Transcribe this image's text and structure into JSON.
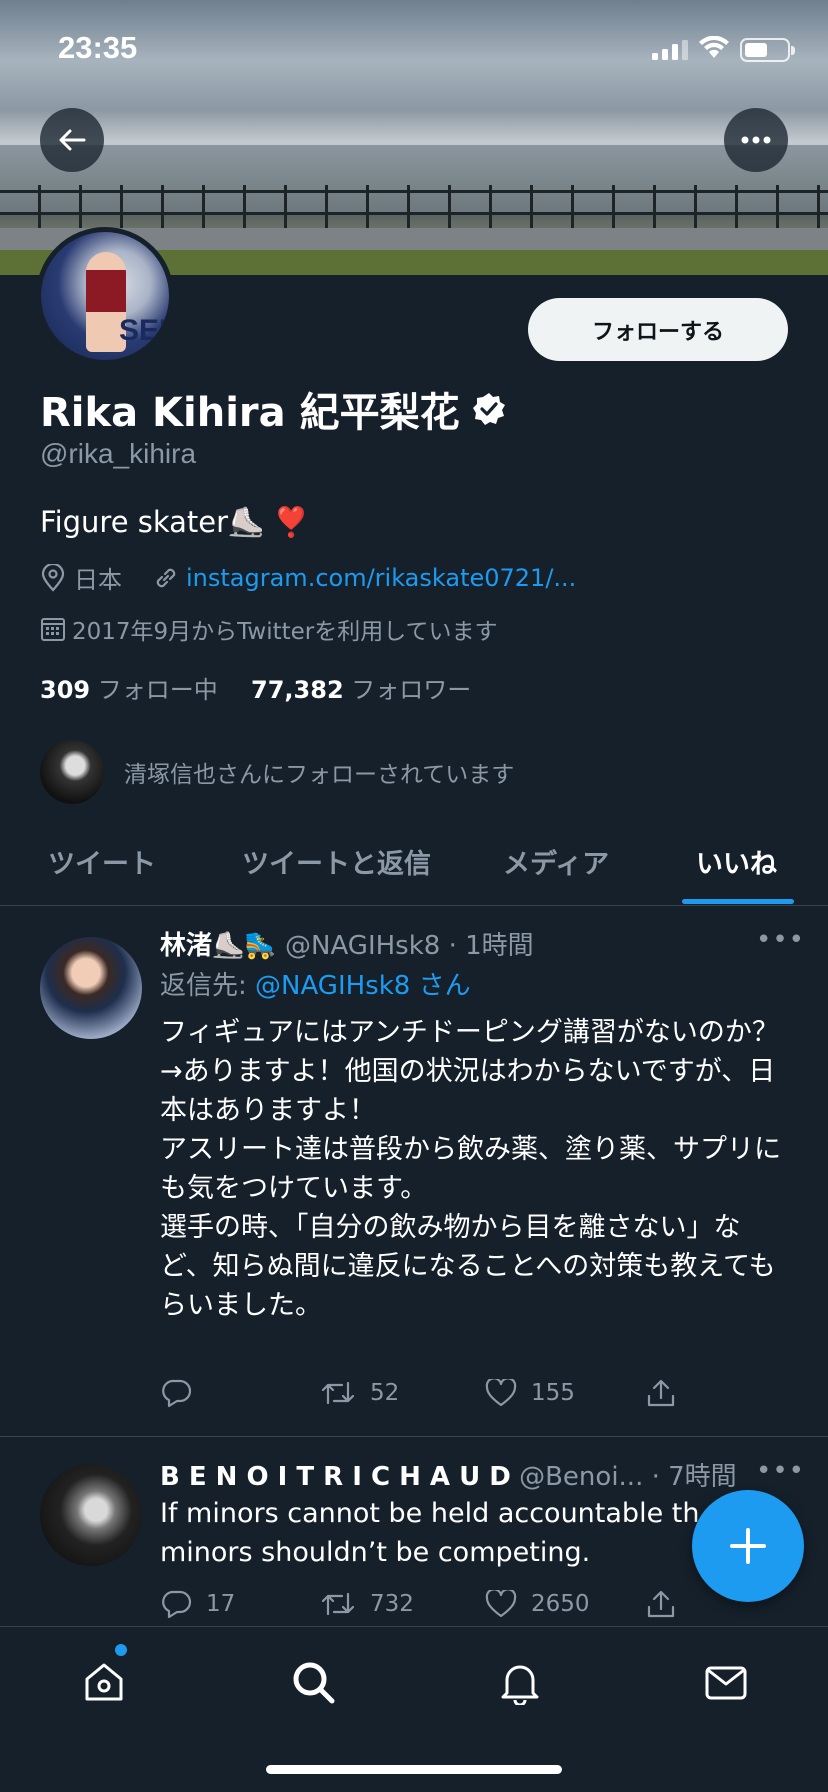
{
  "status_bar": {
    "time": "23:35"
  },
  "profile": {
    "name": "Rika Kihira 紀平梨花",
    "handle": "@rika_kihira",
    "bio": "Figure skater⛸️ ❣️",
    "location": "日本",
    "link": "instagram.com/rikaskate0721/...",
    "joined": "2017年9月からTwitterを利用しています",
    "following_count": "309",
    "following_label": "フォロー中",
    "followers_count": "77,382",
    "followers_label": "フォロワー",
    "followed_by": "清塚信也さんにフォローされています",
    "follow_button": "フォローする",
    "avatar_text": "SEK"
  },
  "tabs": [
    {
      "label": "ツイート"
    },
    {
      "label": "ツイートと返信"
    },
    {
      "label": "メディア"
    },
    {
      "label": "いいね",
      "active": true
    }
  ],
  "tweets": [
    {
      "name": "林渚⛸️🛼",
      "handle": "@NAGIHsk8",
      "time": "· 1時間",
      "reply_prefix": "返信先: ",
      "reply_to": "@NAGIHsk8 さん",
      "text": "フィギュアにはアンチドーピング講習がないのか？\n→ありますよ！他国の状況はわからないですが、日本はありますよ！\nアスリート達は普段から飲み薬、塗り薬、サプリにも気をつけています。\n選手の時、「自分の飲み物から目を離さない」など、知らぬ間に違反になることへの対策も教えてもらいました。",
      "replies": "",
      "retweets": "52",
      "likes": "155"
    },
    {
      "name": "B E N O I T R I C H A U D",
      "handle": "@Benoi...",
      "time": "· 7時間",
      "text": "If minors cannot be held accountable th\nminors shouldn’t be competing.",
      "replies": "17",
      "retweets": "732",
      "likes": "2650"
    }
  ],
  "colors": {
    "accent": "#1d9bf0",
    "background": "#15202b",
    "muted": "#8b98a5",
    "divider": "#38444d"
  },
  "icons": [
    "back-arrow-icon",
    "more-icon",
    "verified-icon",
    "location-icon",
    "link-icon",
    "calendar-icon",
    "reply-icon",
    "retweet-icon",
    "like-icon",
    "share-icon",
    "compose-plus-icon",
    "home-icon",
    "search-icon",
    "notifications-icon",
    "messages-icon"
  ]
}
